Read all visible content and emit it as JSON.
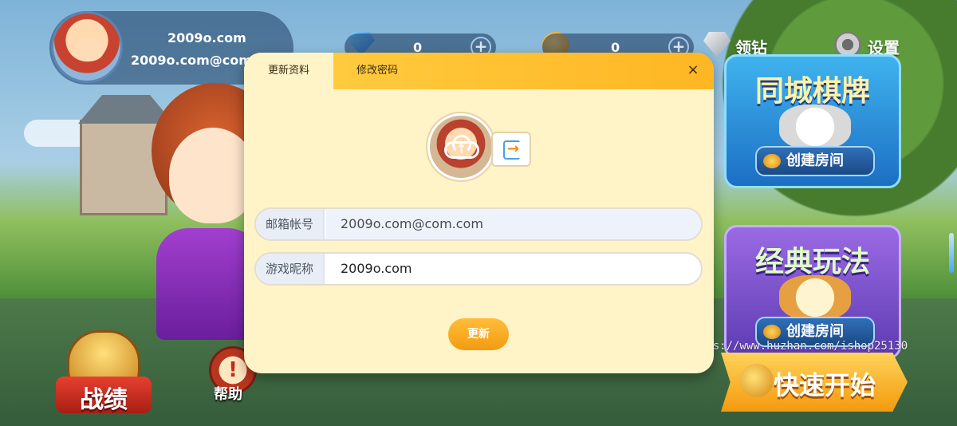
{
  "profile": {
    "name": "2009o.com",
    "email": "2009o.com@com.com"
  },
  "stats": {
    "diamonds": "0",
    "beans": "0",
    "plus_label": "+"
  },
  "top_links": {
    "claim_diamonds": "领钻",
    "settings": "设置"
  },
  "left_buttons": {
    "record": "战绩",
    "help": "帮助",
    "help_symbol": "!"
  },
  "cards": [
    {
      "title": "同城棋牌",
      "action": "创建房间"
    },
    {
      "title": "经典玩法",
      "action": "创建房间"
    }
  ],
  "quick_start": "快速开始",
  "watermark": "https://www.huzhan.com/ishop25130",
  "modal": {
    "tabs": [
      {
        "label": "更新资料",
        "active": true
      },
      {
        "label": "修改密码",
        "active": false
      }
    ],
    "close_label": "×",
    "upload_symbol": "↑",
    "fields": {
      "email": {
        "label": "邮箱帐号",
        "value": "2009o.com@com.com"
      },
      "nickname": {
        "label": "游戏昵称",
        "value": "2009o.com"
      }
    },
    "submit_label": "更新"
  },
  "colors": {
    "modal_bg": "#fff4c8",
    "header_accent": "#ffb623",
    "submit": "#f39b12"
  }
}
